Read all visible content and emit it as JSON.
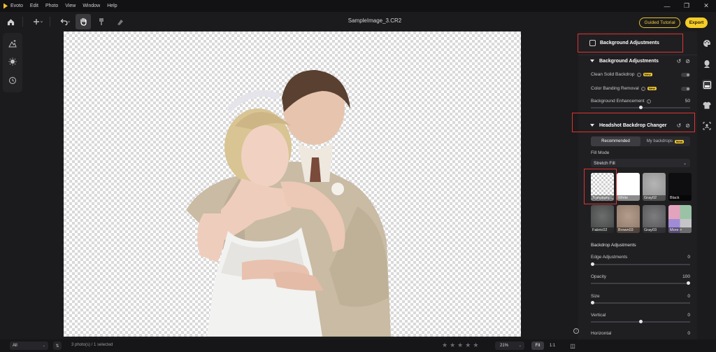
{
  "menubar": {
    "app_name": "Evoto",
    "items": [
      "Edit",
      "Photo",
      "View",
      "Window",
      "Help"
    ],
    "window_controls": [
      "—",
      "❐",
      "✕"
    ]
  },
  "toolbar": {
    "file_title": "SampleImage_3.CR2",
    "guided_label": "Guided Tutorial",
    "export_label": "Export"
  },
  "panel": {
    "header": "Background Adjustments",
    "bg_section": {
      "title": "Background Adjustments",
      "clean_solid": "Clean Solid Backdrop",
      "color_banding": "Color Banding Removal",
      "enhancement": "Background Enhancement",
      "enhancement_value": "50",
      "enhancement_level": 0.5
    },
    "headshot_section": {
      "title": "Headshot Backdrop Changer",
      "tabs": [
        "Recommended",
        "My backdrops"
      ],
      "new_badge": "New",
      "fill_mode_label": "Fill Mode",
      "fill_mode_value": "Stretch Fill",
      "backdrops": [
        "Transpare...",
        "White",
        "Gray02",
        "Black",
        "Fabric02",
        "Brown03",
        "Gray03",
        "More >"
      ]
    },
    "backdrop_adjustments": {
      "title": "Backdrop Adjustments",
      "edge_label": "Edge Adjustments",
      "edge_value": "0",
      "edge_level": 0.0,
      "opacity_label": "Opacity",
      "opacity_value": "100",
      "opacity_level": 1.0,
      "size_label": "Size",
      "size_value": "0",
      "size_level": 0.0,
      "vertical_label": "Vertical",
      "vertical_value": "0",
      "vertical_level": 0.5,
      "horizontal_label": "Horizontal",
      "horizontal_value": "0",
      "horizontal_level": 0.5
    }
  },
  "bottombar": {
    "filter_value": "All",
    "count_text": "3 photo(s) / 1 selected",
    "zoom_value": "21%",
    "fit_label": "Fit",
    "one_to_one_label": "1:1"
  },
  "colors": {
    "accent": "#f6cc26",
    "highlight_box": "#e0332e"
  }
}
